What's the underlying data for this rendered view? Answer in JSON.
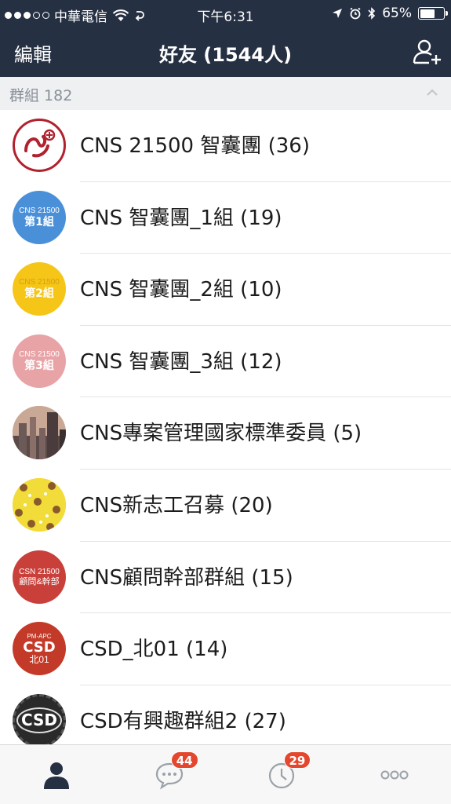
{
  "status_bar": {
    "carrier": "中華電信",
    "time": "下午6:31",
    "battery_percent": "65%",
    "battery_level": 0.65
  },
  "navbar": {
    "edit_label": "編輯",
    "title": "好友 (1544人)"
  },
  "section": {
    "label": "群組 182"
  },
  "groups": [
    {
      "name": "CNS 21500 智囊團 (36)",
      "avatar_lines": [],
      "avatar_color": "#ffffff"
    },
    {
      "name": "CNS 智囊團_1組 (19)",
      "avatar_lines": [
        "CNS 21500",
        "第1組"
      ],
      "avatar_color": "#4a90d9"
    },
    {
      "name": "CNS 智囊團_2組 (10)",
      "avatar_lines": [
        "CNS 21500",
        "第2組"
      ],
      "avatar_color": "#f5c518"
    },
    {
      "name": "CNS 智囊團_3組 (12)",
      "avatar_lines": [
        "CNS 21500",
        "第3組"
      ],
      "avatar_color": "#e8a3a6"
    },
    {
      "name": "CNS專案管理國家標準委員 (5)",
      "avatar_lines": [],
      "avatar_color": "#8a6a5a"
    },
    {
      "name": "CNS新志工召募 (20)",
      "avatar_lines": [],
      "avatar_color": "#f2dc3a"
    },
    {
      "name": "CNS顧問幹部群組 (15)",
      "avatar_lines": [
        "CSN 21500",
        "顧問&幹部"
      ],
      "avatar_color": "#c9403a"
    },
    {
      "name": "CSD_北01 (14)",
      "avatar_lines": [
        "PM-APC",
        "CSD",
        "北01"
      ],
      "avatar_color": "#c43a28"
    },
    {
      "name": "CSD有興趣群組2 (27)",
      "avatar_lines": [
        "CSD"
      ],
      "avatar_color": "#2a2a2a"
    }
  ],
  "tabbar": {
    "chats_badge": "44",
    "timeline_badge": "29"
  },
  "colors": {
    "nav_background": "#263043",
    "badge": "#e4472d",
    "section_background": "#eef0f2"
  }
}
